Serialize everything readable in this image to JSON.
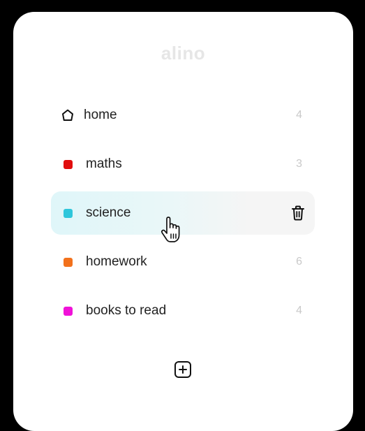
{
  "app": {
    "logo": "alino"
  },
  "lists": [
    {
      "label": "home",
      "count": "4",
      "icon": "house-icon"
    },
    {
      "label": "maths",
      "count": "3",
      "color": "#e10e0e"
    },
    {
      "label": "science",
      "count": "",
      "color": "#2ec6db",
      "active": true,
      "hover_action": "trash-icon"
    },
    {
      "label": "homework",
      "count": "6",
      "color": "#f2711c"
    },
    {
      "label": "books to read",
      "count": "4",
      "color": "#f012d8"
    }
  ],
  "actions": {
    "add": "add-list-icon"
  },
  "colors": {
    "accent_bg": "#dff6f9",
    "count": "#c9c9c9",
    "logo": "#e6e6e6"
  }
}
